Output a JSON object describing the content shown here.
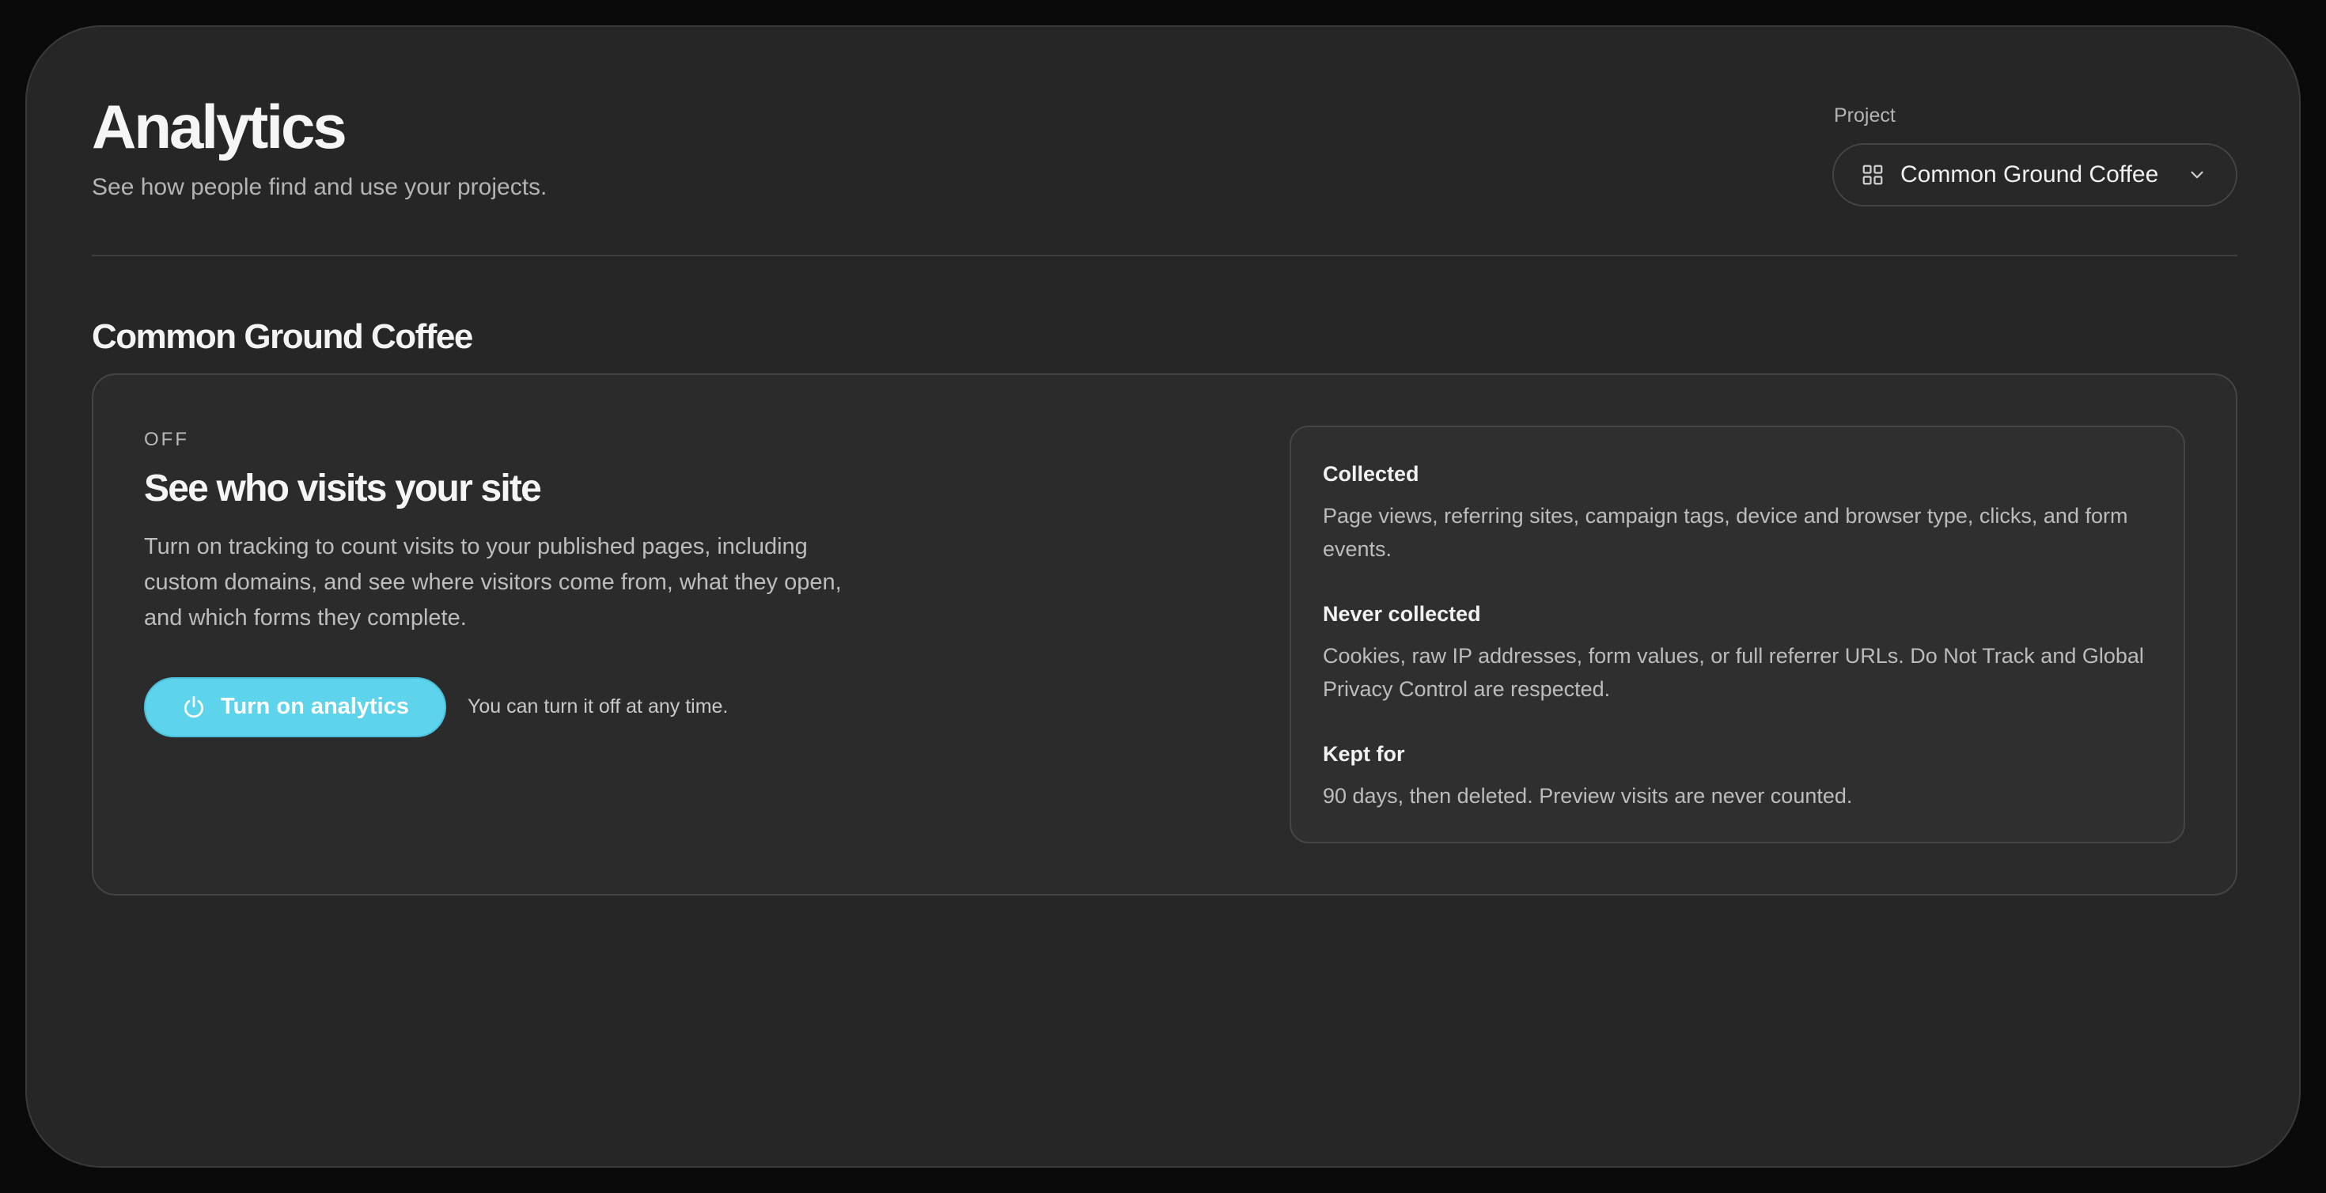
{
  "header": {
    "title": "Analytics",
    "subtitle": "See how people find and use your projects."
  },
  "project_picker": {
    "label": "Project",
    "selected": "Common Ground Coffee",
    "icon": "grid-icon",
    "chevron": "chevron-down-icon"
  },
  "section": {
    "title": "Common Ground Coffee"
  },
  "card": {
    "status": "OFF",
    "heading": "See who visits your site",
    "description": "Turn on tracking to count visits to your published pages, including custom domains, and see where visitors come from, what they open, and which forms they complete.",
    "button_label": "Turn on analytics",
    "button_icon": "power-icon",
    "note": "You can turn it off at any time.",
    "accent_color": "#5ed3ec"
  },
  "info": [
    {
      "title": "Collected",
      "text": "Page views, referring sites, campaign tags, device and browser type, clicks, and form events."
    },
    {
      "title": "Never collected",
      "text": "Cookies, raw IP addresses, form values, or full referrer URLs. Do Not Track and Global Privacy Control are respected."
    },
    {
      "title": "Kept for",
      "text": "90 days, then deleted. Preview visits are never counted."
    }
  ]
}
